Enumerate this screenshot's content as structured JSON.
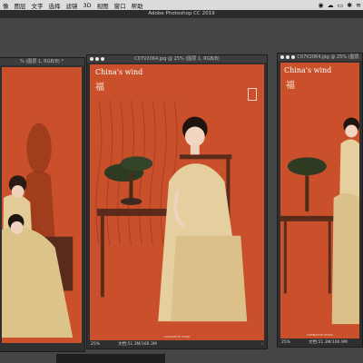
{
  "menubar": {
    "items": [
      "像",
      "图层",
      "文字",
      "选择",
      "滤镜",
      "3D",
      "视图",
      "窗口",
      "帮助"
    ]
  },
  "app_title": "Adobe Photoshop CC 2019",
  "documents": [
    {
      "title": "% (图层 1, RGB/8) *",
      "status_zoom": "",
      "status_size": ""
    },
    {
      "title": "C07V2064.jpg @ 25% (图层 1, RGB/8)",
      "brand": "China's wind",
      "status_zoom": "25%",
      "status_size": "文档:51.3M/166.3M"
    },
    {
      "title": "C07V2064.jpg @ 25% (图层",
      "brand": "China's wind",
      "status_zoom": "25%",
      "status_size": "文档:51.3M/160.9M"
    }
  ],
  "colors": {
    "backdrop": "#c9502a",
    "dress": "#e6cf9f",
    "panel": "#2f2f2f"
  }
}
